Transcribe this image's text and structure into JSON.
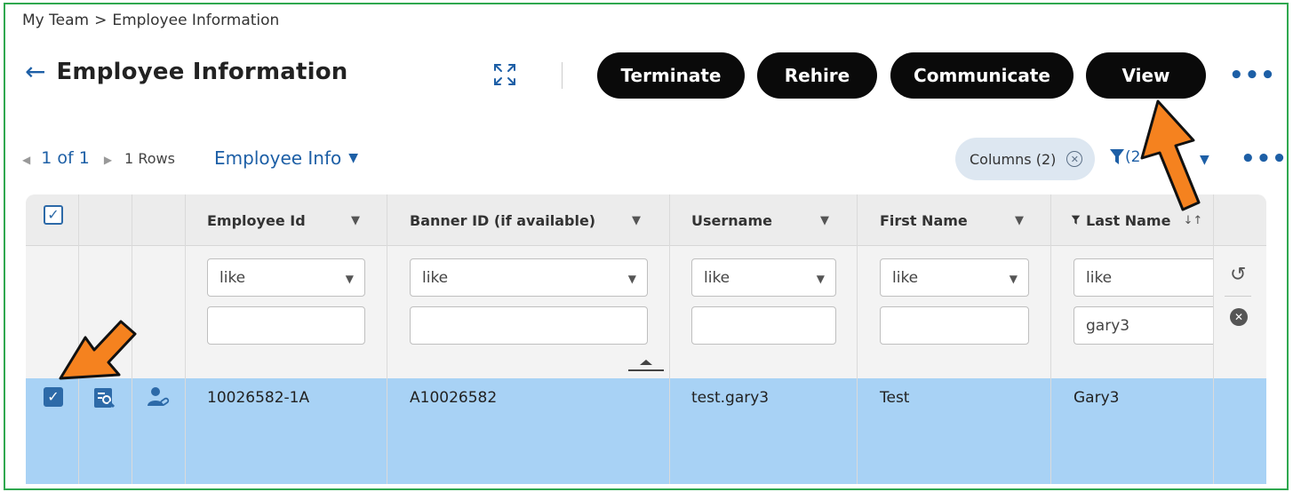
{
  "breadcrumb": {
    "parent": "My Team",
    "separator": ">",
    "current": "Employee Information"
  },
  "header": {
    "title": "Employee Information",
    "buttons": {
      "terminate": "Terminate",
      "rehire": "Rehire",
      "communicate": "Communicate",
      "view": "View"
    },
    "more_label": "•••"
  },
  "toolbar": {
    "page_indicator": "1 of 1",
    "rows_label": "1 Rows",
    "view_name": "Employee Info",
    "columns_chip": "Columns (2)",
    "filter_count": "(2",
    "more_label": "•••"
  },
  "table": {
    "columns": [
      "Employee Id",
      "Banner ID (if available)",
      "Username",
      "First Name",
      "Last Name"
    ],
    "filters": [
      {
        "operator": "like",
        "value": ""
      },
      {
        "operator": "like",
        "value": ""
      },
      {
        "operator": "like",
        "value": ""
      },
      {
        "operator": "like",
        "value": ""
      },
      {
        "operator": "like",
        "value": "gary3"
      }
    ],
    "rows": [
      {
        "employee_id": "10026582-1A",
        "banner_id": "A10026582",
        "username": "test.gary3",
        "first_name": "Test",
        "last_name": "Gary3",
        "selected": true
      }
    ]
  },
  "colors": {
    "frame": "#2fa84f",
    "accent": "#1d5fa6",
    "selected_row": "#a8d2f5",
    "button_bg": "#0a0a0a",
    "arrow": "#f5821f"
  }
}
